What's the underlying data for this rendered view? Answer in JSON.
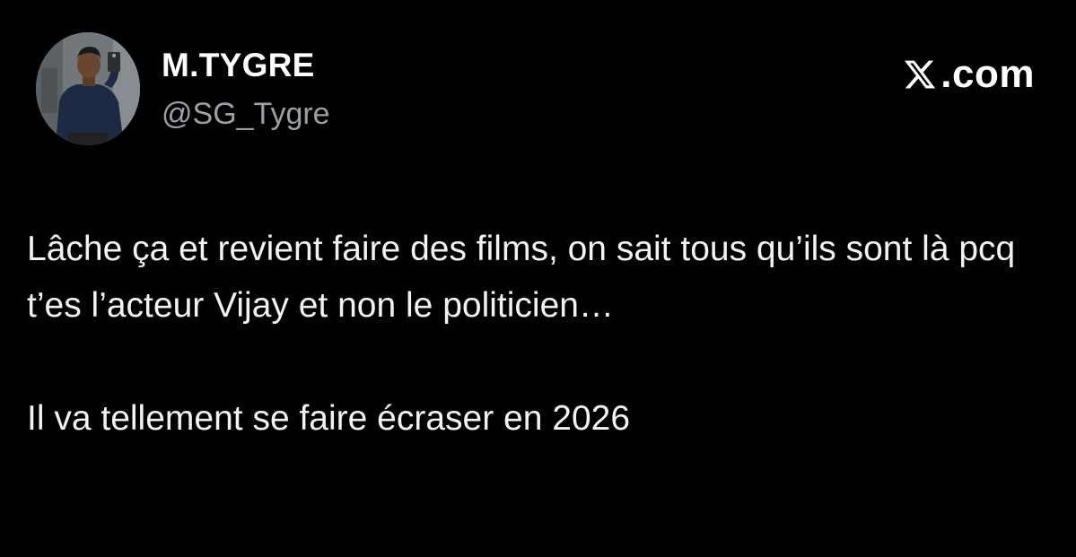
{
  "author": {
    "display_name": "M.TYGRE",
    "handle": "@SG_Tygre",
    "avatar_icon": "profile-photo"
  },
  "brand": {
    "logo_icon": "x-logo-icon",
    "domain_suffix": ".com"
  },
  "tweet": {
    "paragraphs": [
      "Lâche ça et revient faire des films, on sait tous qu’ils sont là pcq t’es l’acteur Vijay et non le politicien…",
      "Il va tellement se faire écraser en 2026"
    ]
  },
  "colors": {
    "background": "#000000",
    "primary_text": "#ffffff",
    "secondary_text": "#9aa0a6"
  }
}
